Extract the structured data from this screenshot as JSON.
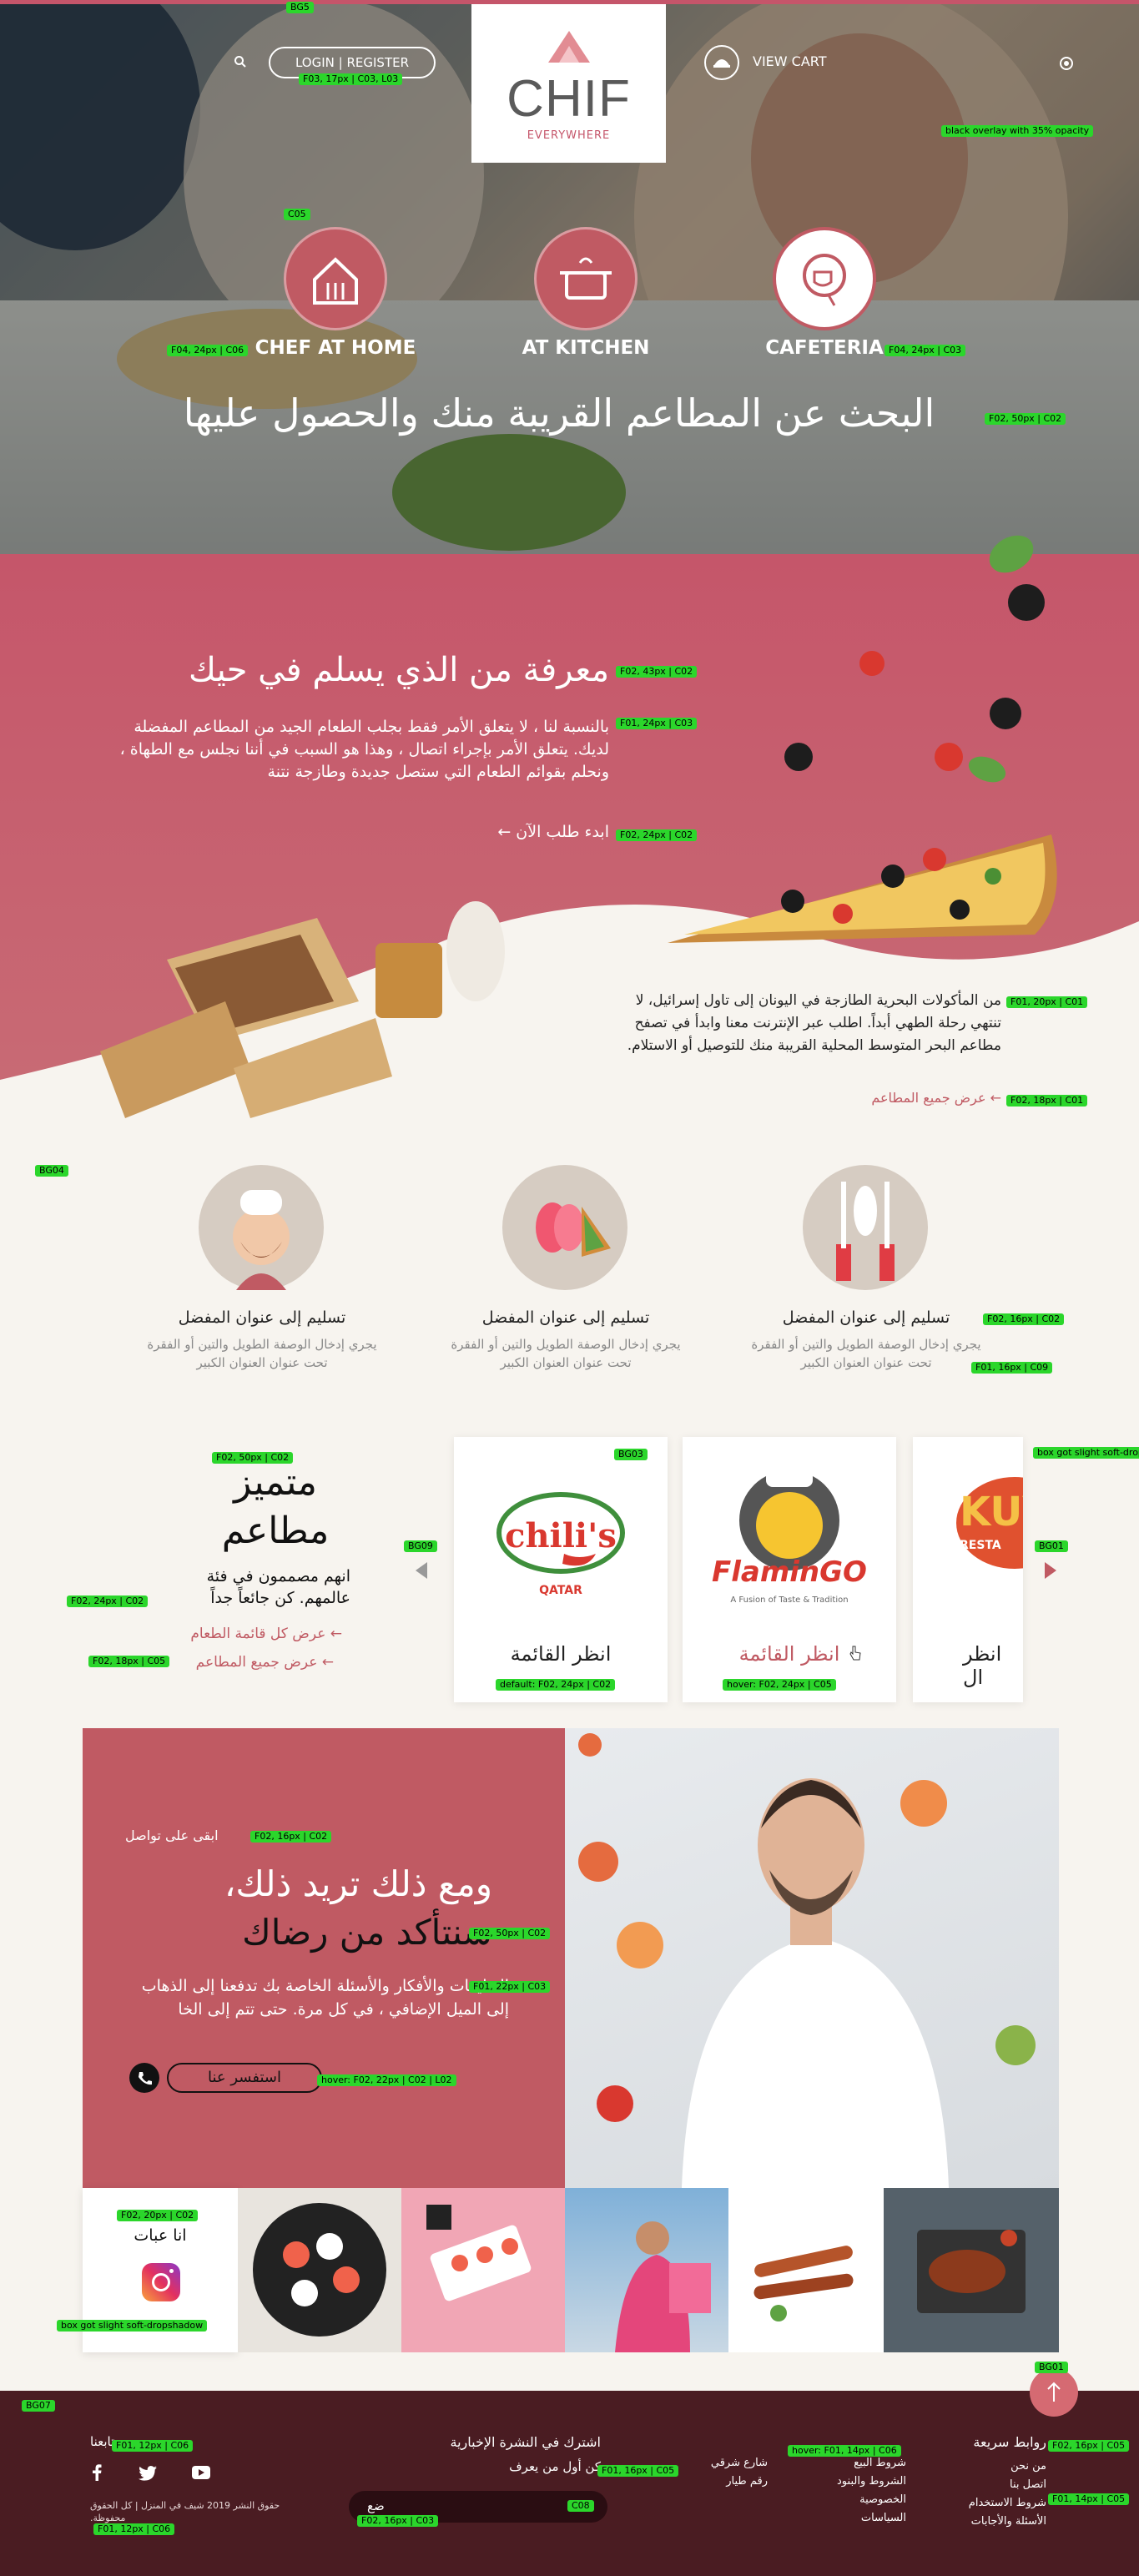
{
  "annotations": {
    "bg5": "BG5",
    "login": "F03, 17px | C03, L03",
    "overlay": "black overlay with 35% opacity",
    "c05": "C05",
    "cat1": "F04, 24px | C06",
    "cat3": "F04, 24px | C03",
    "hero_title": "F02, 50px | C02",
    "about_title": "F02, 43px | C02",
    "about_body": "F01, 24px | C03",
    "about_link": "F02, 24px | C02",
    "seafood_body": "F01, 20px | C01",
    "seafood_link": "F02, 18px | C01",
    "bg04": "BG04",
    "feat_title": "F02, 16px | C02",
    "feat_desc": "F01, 16px | C09",
    "rest_title": "F02, 50px | C02",
    "bg09": "BG09",
    "rest_body": "F02, 24px | C02",
    "rest_link2": "F02, 18px | C05",
    "bg03": "BG03",
    "card_default": "default: F02, 24px | C02",
    "card_hover": "hover: F02, 24px | C05",
    "bg01": "BG01",
    "card_shadow": "box got slight soft-dropshadow",
    "promo_eyebrow": "F02, 16px | C02",
    "promo_title": "F02, 50px | C02",
    "promo_body": "F01, 22px | C03",
    "promo_btn": "hover: F02, 22px | C02 | L02",
    "insta_title": "F02, 20px | C02",
    "insta_shadow": "box got slight soft-dropshadow",
    "bg01b": "BG01",
    "bg07": "BG07",
    "f_follow": "F01, 12px | C06",
    "f_hover": "hover: F01, 14px | C06",
    "f_quick": "F02, 16px | C05",
    "f_news": "F01, 16px | C05",
    "f_c08": "C08",
    "f_input": "F02, 16px | C03",
    "f_copy": "F01, 12px | C06",
    "f_link": "F01, 14px | C05"
  },
  "header": {
    "login": "LOGIN | REGISTER",
    "cart": "VIEW CART",
    "logo_name": "CHIF",
    "logo_sub": "EVERYWHERE"
  },
  "categories": [
    {
      "label": "CHEF AT HOME"
    },
    {
      "label": "AT KITCHEN"
    },
    {
      "label": "CAFETERIA"
    }
  ],
  "hero": {
    "title": "البحث عن المطاعم القريبة منك والحصول عليها"
  },
  "about": {
    "title": "معرفة من الذي يسلم في حيك",
    "body": "بالنسبة لنا ، لا يتعلق الأمر فقط بجلب الطعام الجيد من المطاعم المفضلة لديك. يتعلق الأمر بإجراء اتصال ، وهذا هو السبب في أننا نجلس مع الطهاة ، ونحلم بقوائم الطعام التي ستصل جديدة وطازجة نتنة",
    "link": "ابدء طلب الآن ←",
    "seafood": "من المأكولات البحرية الطازجة في اليونان إلى تاول إسرائيل، لا تنتهي رحلة الطهي أبداً. اطلب عبر الإنترنت معنا وابدأ في تصفح مطاعم البحر المتوسط المحلية القريبة منك للتوصيل أو الاستلام.",
    "seafood_link": "← عرض جميع المطاعم"
  },
  "features": [
    {
      "title": "تسليم إلى عنوان المفضل",
      "desc": "يجري إدخال الوصفة الطويل والتين أو الفقرة تحت عنوان العنوان الكبير"
    },
    {
      "title": "تسليم إلى عنوان المفضل",
      "desc": "يجري إدخال الوصفة الطويل والتين أو الفقرة تحت عنوان العنوان الكبير"
    },
    {
      "title": "تسليم إلى عنوان المفضل",
      "desc": "يجري إدخال الوصفة الطويل والتين أو الفقرة تحت عنوان العنوان الكبير"
    }
  ],
  "restaurants": {
    "title": "متميز مطاعم",
    "body": "انهم مصممون في فئة عالمهم. كن جائعاً جداً",
    "link1": "← عرض كل قائمة الطعام",
    "link2": "← عرض جميع المطاعم",
    "cards": [
      {
        "cta": "انظر القائمة",
        "brand": "chili's",
        "sub": "QATAR",
        "tagline": ""
      },
      {
        "cta": "انظر القائمة",
        "brand": "FlaminGO",
        "sub": "",
        "tagline": "A Fusion of Taste & Tradition"
      },
      {
        "cta": "انظر ال",
        "brand": "KUY",
        "sub": "RESTA",
        "tagline": ""
      }
    ]
  },
  "promo": {
    "eyebrow": "ابقى على تواصل",
    "title_l1": "ومع ذلك تريد ذلك،",
    "title_l2": "سنتأكد من رضاك",
    "body": "التعليقات والأفكار والأسئلة الخاصة بك تدفعنا إلى الذهاب إلى الميل الإضافي ، في كل مرة. حتى تتم إلى الخا",
    "button": "استفسر عنا"
  },
  "insta": {
    "title": "انا عبات"
  },
  "footer": {
    "follow": "تابعنا",
    "copyright": "حقوق النشر 2019 شيف في المنزل | كل الحقوق محفوظة.",
    "newsletter_title": "اشترك في النشرة الإخبارية",
    "newsletter_sub": "كن أول من يعرف",
    "input_label": "ضع",
    "col2": [
      "شارع شرقي",
      "رقم طيار"
    ],
    "col3": [
      "شروط البيع",
      "الشروط والبنود",
      "الخصوصية",
      "السياسات"
    ],
    "quick_title": "روابط سريعة",
    "quick": [
      "من نحن",
      "اتصل بنا",
      "شروط الاستخدام",
      "الأسئلة والأجابات"
    ]
  },
  "colors": {
    "primary": "#c05a63",
    "footer": "#4a1c22",
    "cream": "#f7f4ef"
  }
}
